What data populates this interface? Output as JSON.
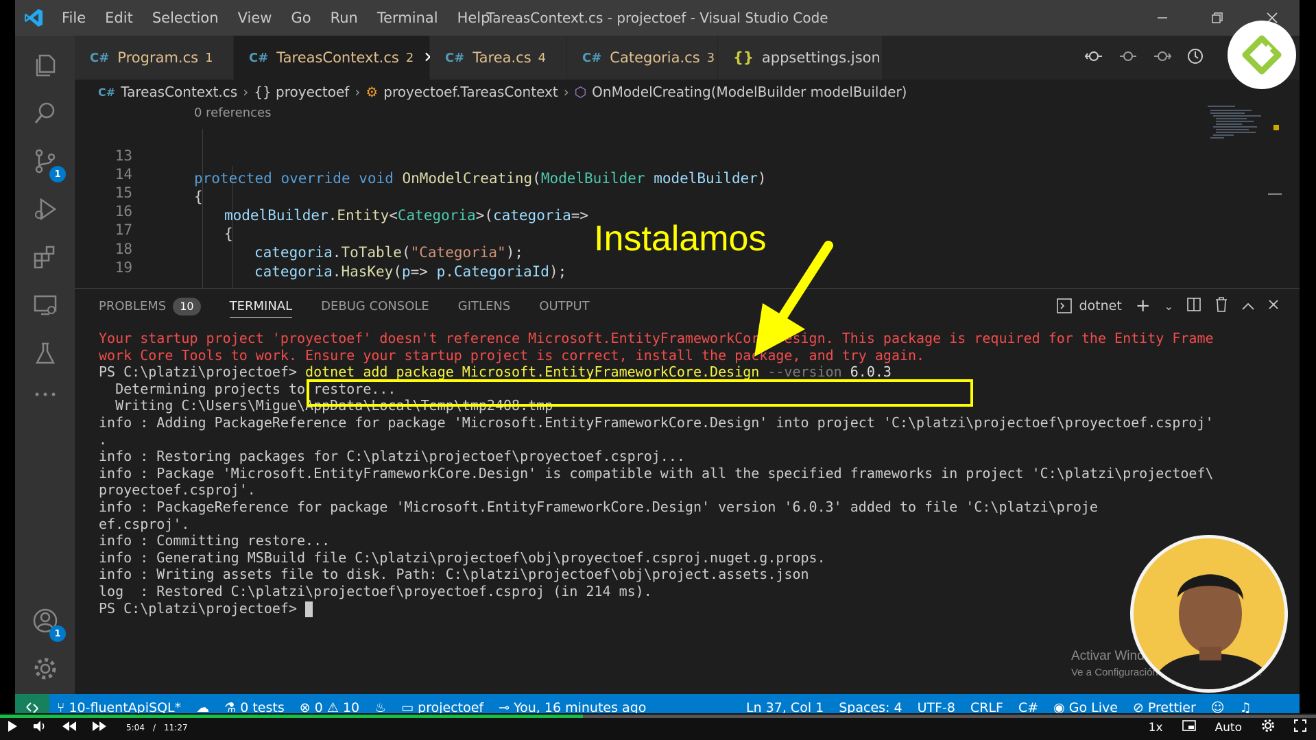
{
  "window": {
    "title": "TareasContext.cs - projectoef - Visual Studio Code",
    "menu": [
      "File",
      "Edit",
      "Selection",
      "View",
      "Go",
      "Run",
      "Terminal",
      "Help"
    ]
  },
  "activity_bar": {
    "source_control_badge": "1",
    "accounts_badge": "1"
  },
  "tabs": [
    {
      "label": "Program.cs",
      "count": "1",
      "icon": "csharp-icon"
    },
    {
      "label": "TareasContext.cs",
      "count": "2",
      "icon": "csharp-icon",
      "active": true
    },
    {
      "label": "Tarea.cs",
      "count": "4",
      "icon": "csharp-icon"
    },
    {
      "label": "Categoria.cs",
      "count": "3",
      "icon": "csharp-icon"
    },
    {
      "label": "appsettings.json",
      "count": "",
      "icon": "json-icon"
    }
  ],
  "breadcrumb": {
    "file": "TareasContext.cs",
    "namespace": "{} proyectoef",
    "class": "proyectoef.TareasContext",
    "method": "OnModelCreating(ModelBuilder modelBuilder)"
  },
  "editor": {
    "codelens": "0 references",
    "line_numbers": [
      "13",
      "14",
      "15",
      "16",
      "17",
      "18",
      "19"
    ],
    "line13": {
      "kw1": "protected",
      "kw2": "override",
      "kw3": "void",
      "fn": "OnModelCreating",
      "p1": "(",
      "ty": "ModelBuilder",
      "var": "modelBuilder",
      "p2": ")"
    },
    "line14": "{",
    "line15": {
      "var": "modelBuilder",
      "p1": ".",
      "fn": "Entity",
      "p2": "<",
      "ty": "Categoria",
      "p3": ">(",
      "arg": "categoria",
      "p4": "=>"
    },
    "line16": "{",
    "line17": {
      "var": "categoria",
      "p1": ".",
      "fn": "ToTable",
      "p2": "(",
      "str": "\"Categoria\"",
      "p3": ");"
    },
    "line18": {
      "var": "categoria",
      "p1": ".",
      "fn": "HasKey",
      "p2": "(",
      "arg": "p",
      "p3": "=> ",
      "arg2": "p",
      "p4": ".",
      "prop": "CategoriaId",
      "p5": ");"
    }
  },
  "panel": {
    "tabs": [
      "PROBLEMS",
      "TERMINAL",
      "DEBUG CONSOLE",
      "GITLENS",
      "OUTPUT"
    ],
    "problems_count": "10",
    "terminal_name": "dotnet"
  },
  "terminal": {
    "error_line1": "Your startup project 'proyectoef' doesn't reference Microsoft.EntityFrameworkCore.Design. This package is required for the Entity Frame",
    "error_line2": "work Core Tools to work. Ensure your startup project is correct, install the package, and try again.",
    "prompt": "PS C:\\platzi\\projectoef>",
    "command": "dotnet add package Microsoft.EntityFrameworkCore.Design",
    "command_flag": "--version",
    "command_version": "6.0.3",
    "output": [
      "  Determining projects to restore...",
      "  Writing C:\\Users\\Migue\\AppData\\Local\\Temp\\tmp2408.tmp",
      "info : Adding PackageReference for package 'Microsoft.EntityFrameworkCore.Design' into project 'C:\\platzi\\projectoef\\proyectoef.csproj'",
      ".",
      "info : Restoring packages for C:\\platzi\\projectoef\\proyectoef.csproj...",
      "info : Package 'Microsoft.EntityFrameworkCore.Design' is compatible with all the specified frameworks in project 'C:\\platzi\\projectoef\\",
      "proyectoef.csproj'.",
      "info : PackageReference for package 'Microsoft.EntityFrameworkCore.Design' version '6.0.3' added to file 'C:\\platzi\\proje",
      "ef.csproj'.",
      "info : Committing restore...",
      "info : Generating MSBuild file C:\\platzi\\projectoef\\obj\\proyectoef.csproj.nuget.g.props.",
      "info : Writing assets file to disk. Path: C:\\platzi\\projectoef\\obj\\project.assets.json",
      "log  : Restored C:\\platzi\\projectoef\\proyectoef.csproj (in 214 ms)."
    ],
    "final_prompt": "PS C:\\platzi\\projectoef>"
  },
  "statusbar": {
    "branch": "10-fluentApiSQL*",
    "tests": "0 tests",
    "errors": "0",
    "warnings": "10",
    "folder": "projectoef",
    "blame": "You, 16 minutes ago",
    "position": "Ln 37, Col 1",
    "spaces": "Spaces: 4",
    "encoding": "UTF-8",
    "eol": "CRLF",
    "language": "C#",
    "golive": "Go Live",
    "prettier": "Prettier"
  },
  "player": {
    "current_time": "5:04",
    "separator": "/",
    "duration": "11:27",
    "progress": 0.443,
    "speed": "1x",
    "quality": "Auto"
  },
  "overlay": {
    "annotation": "Instalamos",
    "watermark_line1": "Activar Windows",
    "watermark_line2": "Ve a Configuración para activar Windows."
  },
  "colors": {
    "accent": "#007acc",
    "highlight": "#ffff00",
    "progress": "#14bf47"
  }
}
